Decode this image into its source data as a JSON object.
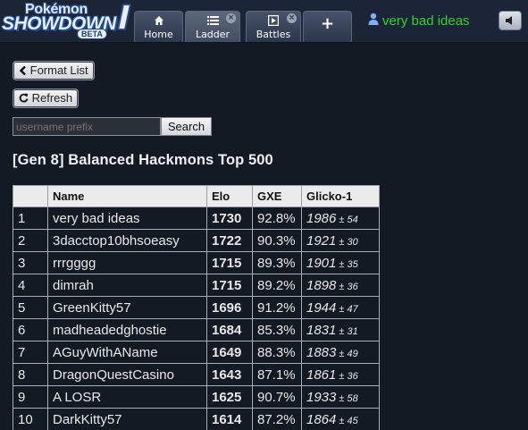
{
  "logo": {
    "line1": "Pokémon",
    "line2": "SHOWDOWN",
    "badge": "BETA"
  },
  "tabs": [
    {
      "label": "Home",
      "icon": "home-icon"
    },
    {
      "label": "Ladder",
      "icon": "list-icon",
      "active": true
    },
    {
      "label": "Battles",
      "icon": "battle-icon"
    }
  ],
  "new_tab_icon": "+",
  "close_glyph": "×",
  "user": {
    "name": "very bad ideas",
    "icon": "user-icon"
  },
  "volume_icon": "volume-icon",
  "controls": {
    "format_list_label": "Format List",
    "refresh_label": "Refresh",
    "search_placeholder": "username prefix",
    "search_label": "Search"
  },
  "ladder": {
    "title": "[Gen 8] Balanced Hackmons Top 500",
    "columns": [
      "",
      "Name",
      "Elo",
      "GXE",
      "Glicko-1"
    ],
    "rows": [
      {
        "rank": "1",
        "name": "very bad ideas",
        "elo": "1730",
        "gxe": "92.8%",
        "glicko": "1986",
        "dev": "54"
      },
      {
        "rank": "2",
        "name": "3dacctop10bhsoeasy",
        "elo": "1722",
        "gxe": "90.3%",
        "glicko": "1921",
        "dev": "30"
      },
      {
        "rank": "3",
        "name": "rrrgggg",
        "elo": "1715",
        "gxe": "89.3%",
        "glicko": "1901",
        "dev": "35"
      },
      {
        "rank": "4",
        "name": "dimrah",
        "elo": "1715",
        "gxe": "89.2%",
        "glicko": "1898",
        "dev": "36"
      },
      {
        "rank": "5",
        "name": "GreenKitty57",
        "elo": "1696",
        "gxe": "91.2%",
        "glicko": "1944",
        "dev": "47"
      },
      {
        "rank": "6",
        "name": "madheadedghostie",
        "elo": "1684",
        "gxe": "85.3%",
        "glicko": "1831",
        "dev": "31"
      },
      {
        "rank": "7",
        "name": "AGuyWithAName",
        "elo": "1649",
        "gxe": "88.3%",
        "glicko": "1883",
        "dev": "49"
      },
      {
        "rank": "8",
        "name": "DragonQuestCasino",
        "elo": "1643",
        "gxe": "87.1%",
        "glicko": "1861",
        "dev": "36"
      },
      {
        "rank": "9",
        "name": "A LOSR",
        "elo": "1625",
        "gxe": "90.7%",
        "glicko": "1933",
        "dev": "58"
      },
      {
        "rank": "10",
        "name": "DarkKitty57",
        "elo": "1614",
        "gxe": "87.2%",
        "glicko": "1864",
        "dev": "45"
      }
    ]
  },
  "colors": {
    "background": "#141a24",
    "username": "#2ed32e",
    "header": "#1b2535"
  }
}
